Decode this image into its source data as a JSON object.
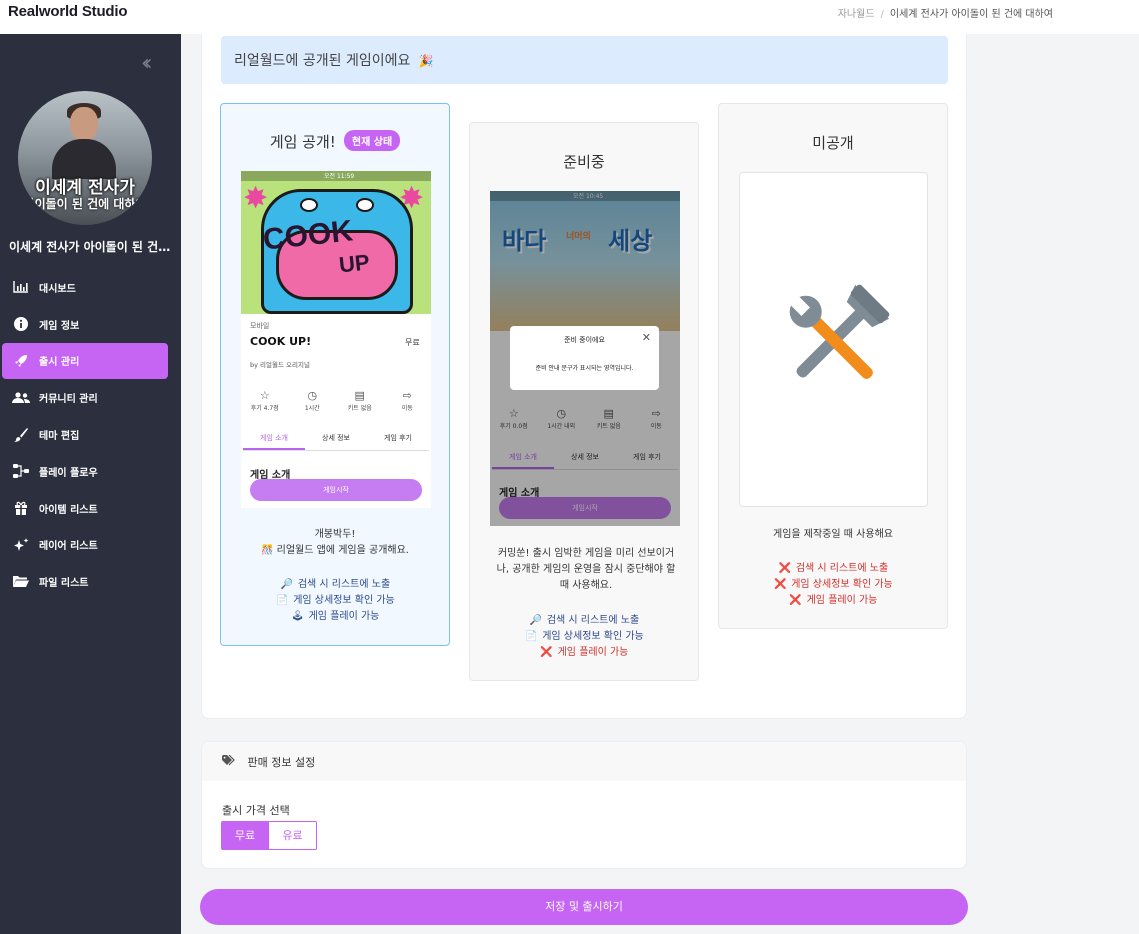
{
  "app": {
    "brand": "Realworld Studio"
  },
  "breadcrumb": {
    "root": "자나월드",
    "sep": "/",
    "current": "이세계 전사가 아이돌이 된 건에 대하여"
  },
  "sidebar": {
    "collapse_icon": "double-chevron-left",
    "avatar_overlay_line1": "이세계 전사가",
    "avatar_overlay_line2": "아이돌이 된 건에 대하여",
    "project_title": "이세계 전사가 아이돌이 된 건에 대하여",
    "items": [
      {
        "label": "대시보드",
        "icon": "bar-chart-icon",
        "active": false
      },
      {
        "label": "게임 정보",
        "icon": "info-icon",
        "active": false
      },
      {
        "label": "출시 관리",
        "icon": "rocket-icon",
        "active": true
      },
      {
        "label": "커뮤니티 관리",
        "icon": "users-icon",
        "active": false
      },
      {
        "label": "테마 편집",
        "icon": "brush-icon",
        "active": false
      },
      {
        "label": "플레이 플로우",
        "icon": "flow-icon",
        "active": false
      },
      {
        "label": "아이템 리스트",
        "icon": "gift-icon",
        "active": false
      },
      {
        "label": "레이어 리스트",
        "icon": "sparkle-icon",
        "active": false
      },
      {
        "label": "파일 리스트",
        "icon": "folder-icon",
        "active": false
      }
    ]
  },
  "banner": {
    "text": "리얼월드에 공개된 게임이에요",
    "emoji": "🎉"
  },
  "status_cards": {
    "published": {
      "title": "게임 공개!",
      "badge": "현재 상태",
      "desc_line1": "개봉박두!",
      "desc_line2": "리얼월드 앱에 게임을 공개해요.",
      "features": [
        {
          "icon": "🔎",
          "text": "검색 시 리스트에 노출",
          "enabled": true
        },
        {
          "icon": "📄",
          "text": "게임 상세정보 확인 가능",
          "enabled": true
        },
        {
          "icon": "🕹",
          "text": "게임 플레이 가능",
          "enabled": true
        }
      ],
      "preview": {
        "status_time": "오전 11:59",
        "category": "모바일",
        "game_name": "COOK UP!",
        "price": "무료",
        "author": "by 리얼월드 오리지널",
        "stats": [
          "후기 4.7점",
          "1시간",
          "키트 없음",
          "이동"
        ],
        "tabs": [
          "게임 소개",
          "상세 정보",
          "게임 후기"
        ],
        "intro": "게임 소개",
        "start_button": "게임시작",
        "cover_line1": "COOK",
        "cover_line2": "UP"
      }
    },
    "preparing": {
      "title": "준비중",
      "desc": "커밍쑨! 출시 임박한 게임을 미리 선보이거나, 공개한 게임의 운영을 잠시 중단해야 할 때 사용해요.",
      "features": [
        {
          "icon": "🔎",
          "text": "검색 시 리스트에 노출",
          "enabled": true
        },
        {
          "icon": "📄",
          "text": "게임 상세정보 확인 가능",
          "enabled": true
        },
        {
          "icon": "❌",
          "text": "게임 플레이 가능",
          "enabled": false
        }
      ],
      "preview": {
        "status_time": "오전 10:45",
        "cover_title1": "바다",
        "cover_sub": "너머의",
        "cover_title2": "세상",
        "modal_title": "준비 중이에요",
        "modal_body": "준비 안내 문구가 표시되는 영역입니다.",
        "stats": [
          "후기 0.0점",
          "1시간 내외",
          "키트 없음",
          "이동"
        ],
        "tabs": [
          "게임 소개",
          "상세 정보",
          "게임 후기"
        ],
        "intro": "게임 소개",
        "start_button": "게임시작"
      }
    },
    "private": {
      "title": "미공개",
      "desc": "게임을 제작중일 때 사용해요",
      "features": [
        {
          "icon": "❌",
          "text": "검색 시 리스트에 노출",
          "enabled": false
        },
        {
          "icon": "❌",
          "text": "게임 상세정보 확인 가능",
          "enabled": false
        },
        {
          "icon": "❌",
          "text": "게임 플레이 가능",
          "enabled": false
        }
      ]
    }
  },
  "sales": {
    "header": "판매 정보 설정",
    "price_label": "출시 가격 선택",
    "options": [
      "무료",
      "유료"
    ],
    "selected": "무료"
  },
  "save_button": "저장 및 출시하기",
  "colors": {
    "accent": "#c665f4",
    "sidebar_bg": "#2c2f3d",
    "banner_bg": "#dcebfd",
    "current_border": "#7ec0ee",
    "disabled_red": "#d0302a"
  }
}
